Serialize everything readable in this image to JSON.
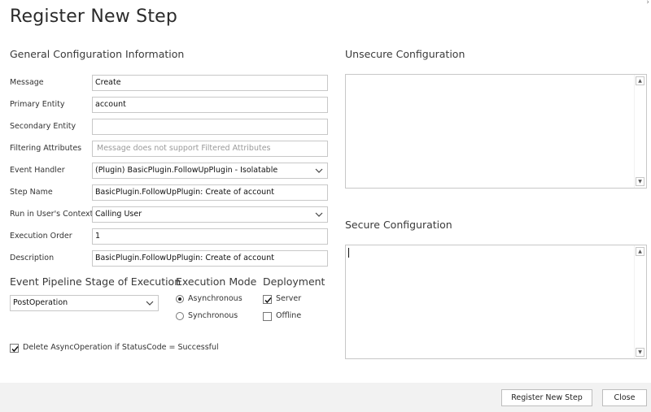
{
  "dialog": {
    "title": "Register New Step",
    "close_glyph": "›"
  },
  "general": {
    "heading": "General Configuration Information",
    "message": {
      "label": "Message",
      "value": "Create"
    },
    "primary_entity": {
      "label": "Primary Entity",
      "value": "account"
    },
    "secondary_entity": {
      "label": "Secondary Entity",
      "value": ""
    },
    "filtering_attributes": {
      "label": "Filtering Attributes",
      "placeholder": "Message does not support Filtered Attributes"
    },
    "event_handler": {
      "label": "Event Handler",
      "value": "(Plugin) BasicPlugin.FollowUpPlugin - Isolatable"
    },
    "step_name": {
      "label": "Step Name",
      "value": "BasicPlugin.FollowUpPlugin: Create of account"
    },
    "run_context": {
      "label": "Run in User's Context",
      "value": "Calling User"
    },
    "execution_order": {
      "label": "Execution Order",
      "value": "1"
    },
    "description": {
      "label": "Description",
      "value": "BasicPlugin.FollowUpPlugin: Create of account"
    }
  },
  "pipeline": {
    "heading": "Event Pipeline Stage of Execution",
    "value": "PostOperation"
  },
  "execution_mode": {
    "heading": "Execution Mode",
    "options": [
      {
        "label": "Asynchronous",
        "selected": true
      },
      {
        "label": "Synchronous",
        "selected": false
      }
    ]
  },
  "deployment": {
    "heading": "Deployment",
    "options": [
      {
        "label": "Server",
        "checked": true
      },
      {
        "label": "Offline",
        "checked": false
      }
    ]
  },
  "delete_async": {
    "label": "Delete AsyncOperation if StatusCode = Successful",
    "checked": true
  },
  "unsecure": {
    "heading": "Unsecure  Configuration",
    "value": ""
  },
  "secure": {
    "heading": "Secure  Configuration",
    "value": ""
  },
  "footer": {
    "register_label": "Register New Step",
    "close_label": "Close"
  }
}
